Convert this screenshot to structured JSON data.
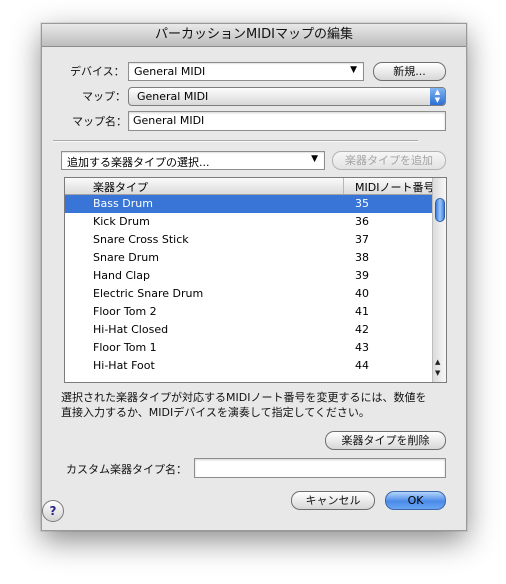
{
  "window": {
    "title": "パーカッションMIDIマップの編集"
  },
  "device": {
    "label": "デバイス：",
    "value": "General MIDI",
    "new_button": "新規..."
  },
  "map": {
    "label": "マップ：",
    "value": "General MIDI"
  },
  "mapname": {
    "label": "マップ名：",
    "value": "General MIDI"
  },
  "instrument_picker": {
    "value": "追加する楽器タイプの選択...",
    "add_button": "楽器タイプを追加"
  },
  "table": {
    "headers": [
      "楽器タイプ",
      "MIDIノート番号"
    ],
    "rows": [
      {
        "name": "Bass Drum",
        "note": "35"
      },
      {
        "name": "Kick Drum",
        "note": "36"
      },
      {
        "name": "Snare Cross Stick",
        "note": "37"
      },
      {
        "name": "Snare Drum",
        "note": "38"
      },
      {
        "name": "Hand Clap",
        "note": "39"
      },
      {
        "name": "Electric Snare Drum",
        "note": "40"
      },
      {
        "name": "Floor Tom 2",
        "note": "41"
      },
      {
        "name": "Hi-Hat Closed",
        "note": "42"
      },
      {
        "name": "Floor Tom 1",
        "note": "43"
      },
      {
        "name": "Hi-Hat Foot",
        "note": "44"
      }
    ],
    "selected_index": 0
  },
  "description": {
    "line1": "選択された楽器タイプが対応するMIDIノート番号を変更するには、数値を",
    "line2": "直接入力するか、MIDIデバイスを演奏して指定してください。"
  },
  "delete_button": "楽器タイプを削除",
  "custom": {
    "label": "カスタム楽器タイプ名：",
    "value": ""
  },
  "footer": {
    "cancel": "キャンセル",
    "ok": "OK",
    "help": "?"
  },
  "colors": {
    "selection": "#3875d7",
    "primary_button": "#4a8ae8"
  }
}
